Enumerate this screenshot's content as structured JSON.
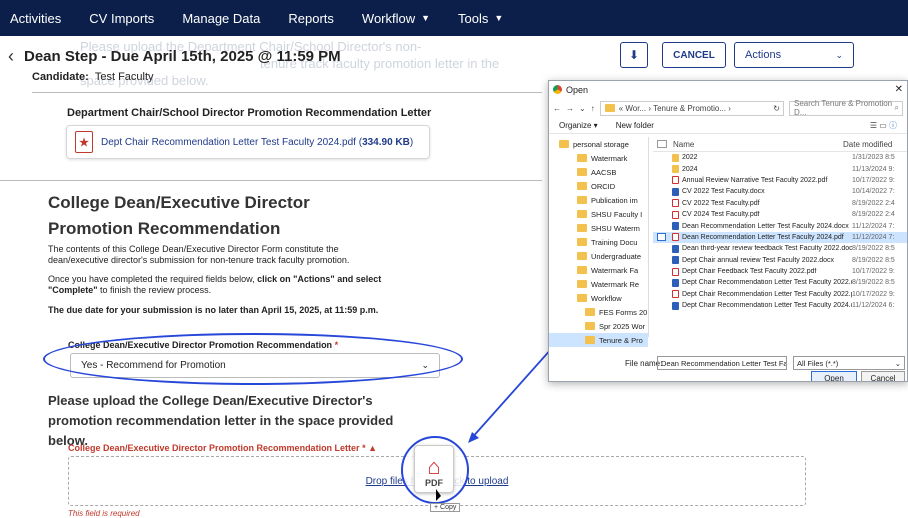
{
  "nav": {
    "items": [
      {
        "label": "Activities",
        "caret": false
      },
      {
        "label": "CV Imports",
        "caret": false
      },
      {
        "label": "Manage Data",
        "caret": false
      },
      {
        "label": "Reports",
        "caret": false
      },
      {
        "label": "Workflow",
        "caret": true
      },
      {
        "label": "Tools",
        "caret": true
      }
    ]
  },
  "ghost": {
    "line1": "Please upload the Department Chair/School Director's non-",
    "line2": "tenure track faculty promotion letter in the",
    "line3": "space provided below."
  },
  "header": {
    "title": "Dean Step - Due April 15th, 2025 @ 11:59 PM",
    "candidate_label": "Candidate:",
    "candidate_name": "Test Faculty",
    "download_glyph": "⬇",
    "cancel_label": "CANCEL",
    "actions_label": "Actions"
  },
  "chair_section": {
    "title": "Department Chair/School Director Promotion Recommendation Letter",
    "file_name": "Dept Chair Recommendation Letter Test Faculty 2024.pdf",
    "file_size": "334.90 KB"
  },
  "dean_section": {
    "title": "College Dean/Executive Director Promotion Recommendation",
    "para1": "The contents of this College Dean/Executive Director Form constitute the dean/executive director's submission for non-tenure track faculty promotion.",
    "para2_pre": "Once you have completed the required fields below, ",
    "para2_bold": "click on \"Actions\" and select \"Complete\"",
    "para2_post": " to finish the review process.",
    "para3": "The due date for your submission is no later than April 15, 2025, at 11:59 p.m.",
    "select_label": "College Dean/Executive Director Promotion Recommendation",
    "select_value": "Yes - Recommend for Promotion",
    "upload_title": "Please upload the College Dean/Executive Director's promotion recommendation letter in the space provided below.",
    "upload_label": "College Dean/Executive Director Promotion Recommendation Letter",
    "drop_text": "Drop files here or click to upload",
    "required_text": "This field is required",
    "drag_label": "PDF",
    "copy_label": "+ Copy"
  },
  "dialog": {
    "title": "Open",
    "path": "« Wor... › Tenure & Promotio... ›",
    "search_placeholder": "Search Tenure & Promotion D...",
    "organize": "Organize ▾",
    "new_folder": "New folder",
    "col_name": "Name",
    "col_date": "Date modified",
    "tree": [
      "personal storage",
      "Watermark",
      "AACSB",
      "ORCID",
      "Publication im",
      "SHSU Faculty I",
      "SHSU Waterm",
      "Training Docu",
      "Undergraduate",
      "Watermark Fa",
      "Watermark Re",
      "Workflow",
      "FES Forms 20",
      "Spr 2025 Wor",
      "Tenure & Pro"
    ],
    "files": [
      {
        "name": "2022",
        "date": "1/31/2023 8:5",
        "type": "fold"
      },
      {
        "name": "2024",
        "date": "11/13/2024 9:",
        "type": "fold"
      },
      {
        "name": "Annual Review Narrative Test Faculty 2022.pdf",
        "date": "10/17/2022 9:",
        "type": "pdf"
      },
      {
        "name": "CV 2022 Test Faculty.docx",
        "date": "10/14/2022 7:",
        "type": "doc"
      },
      {
        "name": "CV 2022 Test Faculty.pdf",
        "date": "8/19/2022 2:4",
        "type": "pdf"
      },
      {
        "name": "CV 2024 Test Faculty.pdf",
        "date": "8/19/2022 2:4",
        "type": "pdf"
      },
      {
        "name": "Dean Recommendation Letter Test Faculty 2024.docx",
        "date": "11/12/2024 7:",
        "type": "doc"
      },
      {
        "name": "Dean Recommendation Letter Test Faculty 2024.pdf",
        "date": "11/12/2024 7:",
        "type": "pdf"
      },
      {
        "name": "Dean third-year review feedback Test Faculty 2022.docx",
        "date": "8/19/2022 8:5",
        "type": "doc"
      },
      {
        "name": "Dept Chair annual review Test Faculty 2022.docx",
        "date": "8/19/2022 8:5",
        "type": "doc"
      },
      {
        "name": "Dept Chair Feedback Test Faculty 2022.pdf",
        "date": "10/17/2022 9:",
        "type": "pdf"
      },
      {
        "name": "Dept Chair Recommendation Letter Test Faculty 2022.d...",
        "date": "8/19/2022 8:5",
        "type": "doc"
      },
      {
        "name": "Dept Chair Recommendation Letter Test Faculty 2022.pdf",
        "date": "10/17/2022 9:",
        "type": "pdf"
      },
      {
        "name": "Dept Chair Recommendation Letter Test Faculty 2024.d...",
        "date": "11/12/2024 6:",
        "type": "doc"
      }
    ],
    "filename_label": "File name:",
    "filename_value": "Dean Recommendation Letter Test Fac",
    "filetype_value": "All Files (*.*)",
    "open_label": "Open",
    "cancel_label": "Cancel"
  },
  "colors": {
    "nav_bg": "#0b1f4a",
    "accent": "#1f3a8a",
    "highlight": "#2747d8",
    "error": "#c0392b"
  }
}
